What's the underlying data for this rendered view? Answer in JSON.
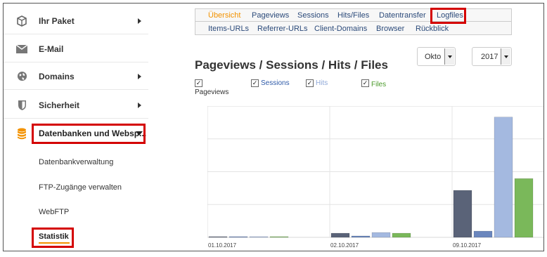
{
  "sidebar": {
    "items": [
      {
        "label": "Ihr Paket",
        "icon": "package-icon"
      },
      {
        "label": "E-Mail",
        "icon": "mail-icon"
      },
      {
        "label": "Domains",
        "icon": "globe-icon"
      },
      {
        "label": "Sicherheit",
        "icon": "shield-icon"
      },
      {
        "label": "Datenbanken und Websp...",
        "icon": "database-icon"
      }
    ],
    "subitems": [
      "Datenbankverwaltung",
      "FTP-Zugänge verwalten",
      "WebFTP",
      "Statistik"
    ]
  },
  "tabs": {
    "row1": [
      "Übersicht",
      "Pageviews",
      "Sessions",
      "Hits/Files",
      "Datentransfer",
      "Logfiles"
    ],
    "row2": [
      "Items-URLs",
      "Referrer-URLs",
      "Client-Domains",
      "Browser",
      "Rückblick"
    ]
  },
  "main": {
    "title": "Pageviews / Sessions / Hits / Files",
    "month": "Okto",
    "year": "2017"
  },
  "legend": [
    {
      "label": "Pageviews",
      "color": "#333333"
    },
    {
      "label": "Sessions",
      "color": "#2e5aa8"
    },
    {
      "label": "Hits",
      "color": "#8fa8d8"
    },
    {
      "label": "Files",
      "color": "#4a9a2a"
    }
  ],
  "chart_data": {
    "type": "bar",
    "categories": [
      "01.10.2017",
      "02.10.2017",
      "09.10.2017"
    ],
    "series": [
      {
        "name": "Pageviews",
        "values": [
          1,
          6,
          68
        ]
      },
      {
        "name": "Sessions",
        "values": [
          1,
          2,
          9
        ]
      },
      {
        "name": "Hits",
        "values": [
          1,
          7,
          174
        ]
      },
      {
        "name": "Files",
        "values": [
          1,
          6,
          85
        ]
      }
    ],
    "colors": [
      "#5a6378",
      "#6a86bd",
      "#a4b9e0",
      "#7ab85a"
    ],
    "ylim": [
      0,
      190
    ],
    "grid": true
  }
}
